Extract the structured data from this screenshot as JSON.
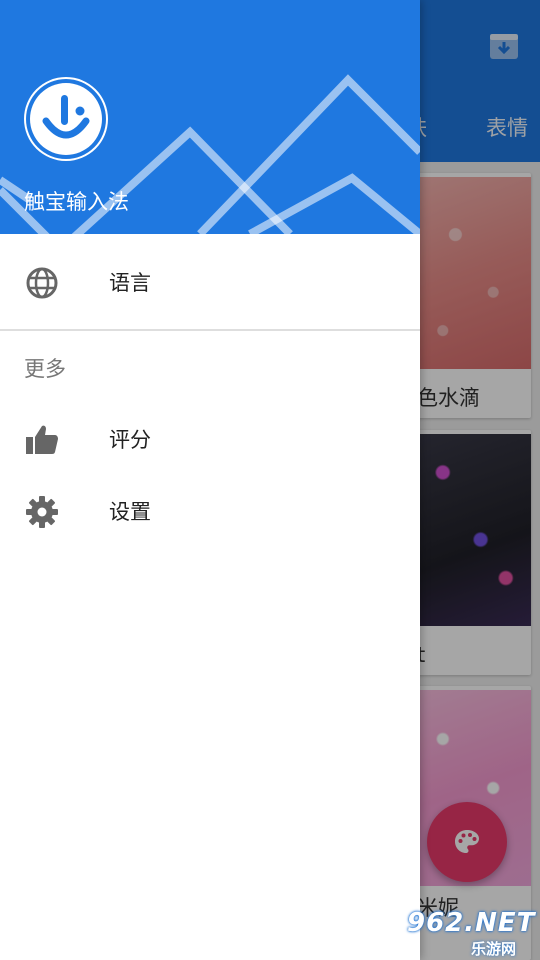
{
  "background_app": {
    "tabs": [
      {
        "label": "肤"
      },
      {
        "label": "表情"
      }
    ],
    "cards": [
      {
        "title": "色水滴"
      },
      {
        "title": "t"
      },
      {
        "title": "米妮"
      }
    ],
    "icons": {
      "store": "download-box-icon",
      "fab": "palette-icon"
    }
  },
  "drawer": {
    "header": {
      "app_name": "触宝输入法",
      "logo_icon": "touchpal-logo-icon",
      "background_color": "#1f78e0"
    },
    "items": [
      {
        "label": "语言",
        "icon": "globe-icon"
      }
    ],
    "section_title": "更多",
    "more_items": [
      {
        "label": "评分",
        "icon": "thumbs-up-icon"
      },
      {
        "label": "设置",
        "icon": "gear-icon"
      }
    ]
  },
  "watermark": {
    "top_text": "962.NET",
    "bottom_text": "乐游网"
  },
  "colors": {
    "primary": "#1f78e0",
    "fab": "#e83a6a",
    "scrim": "rgba(0,0,0,0.35)"
  }
}
